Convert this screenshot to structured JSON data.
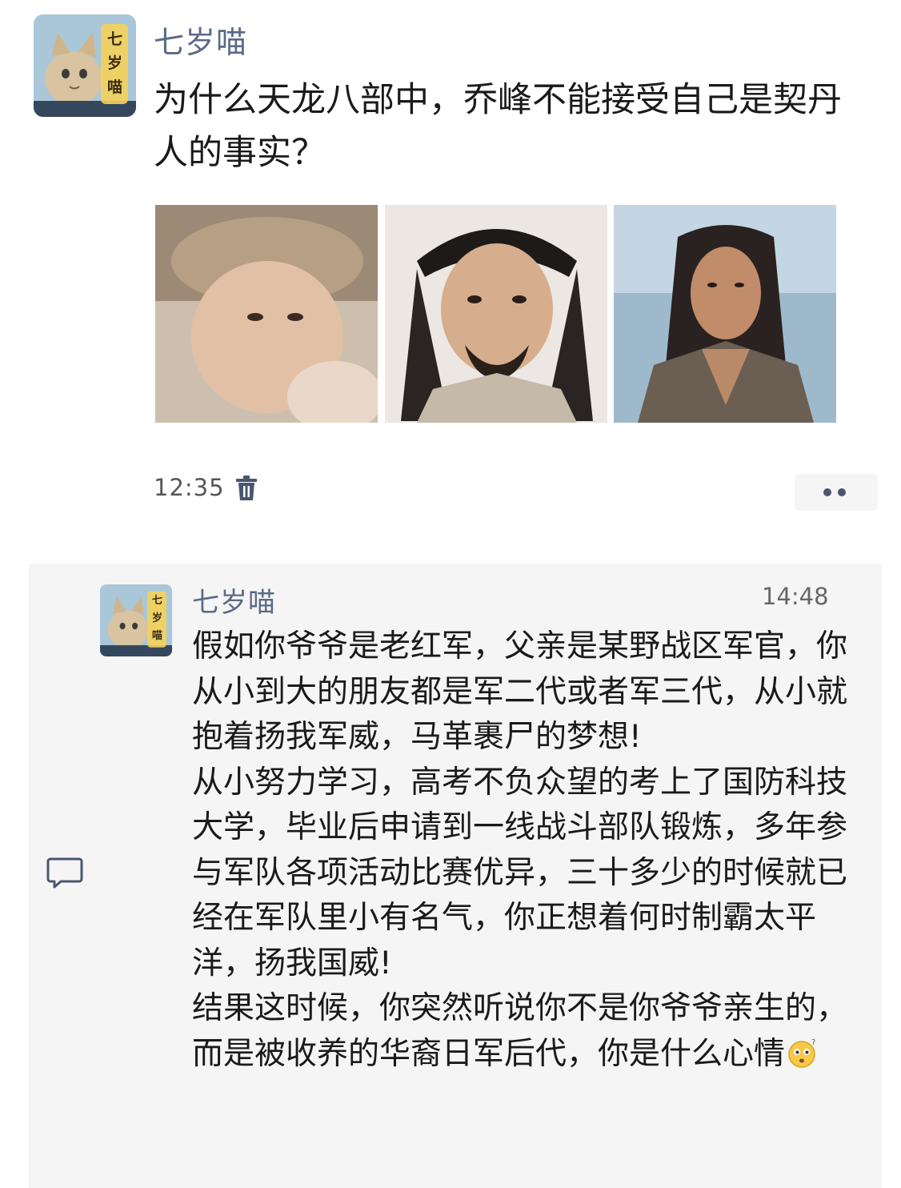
{
  "post": {
    "author": "七岁喵",
    "avatar_text": "七岁喵",
    "question": "为什么天龙八部中，乔峰不能接受自己是契丹人的事实？",
    "time": "12:35",
    "images": [
      "image-1",
      "image-2",
      "image-3"
    ]
  },
  "comment": {
    "author": "七岁喵",
    "avatar_text": "七岁喵",
    "time": "14:48",
    "paragraphs": [
      "假如你爷爷是老红军，父亲是某野战区军官，你从小到大的朋友都是军二代或者军三代，从小就抱着扬我军威，马革裹尸的梦想!",
      "从小努力学习，高考不负众望的考上了国防科技大学，毕业后申请到一线战斗部队锻炼，多年参与军队各项活动比赛优异，三十多少的时候就已经在军队里小有名气，你正想着何时制霸太平洋，扬我国威!",
      "结果这时候，你突然听说你不是你爷爷亲生的，而是被收养的华裔日军后代，你是什么心情"
    ]
  },
  "icons": {
    "trash": "trash-icon",
    "comment": "comment-icon",
    "more": "more-dots-icon",
    "emoji": "thinking-emoji-icon"
  },
  "colors": {
    "author": "#5a6a86",
    "comment_bg": "#f5f5f5",
    "icon": "#4a5670"
  }
}
